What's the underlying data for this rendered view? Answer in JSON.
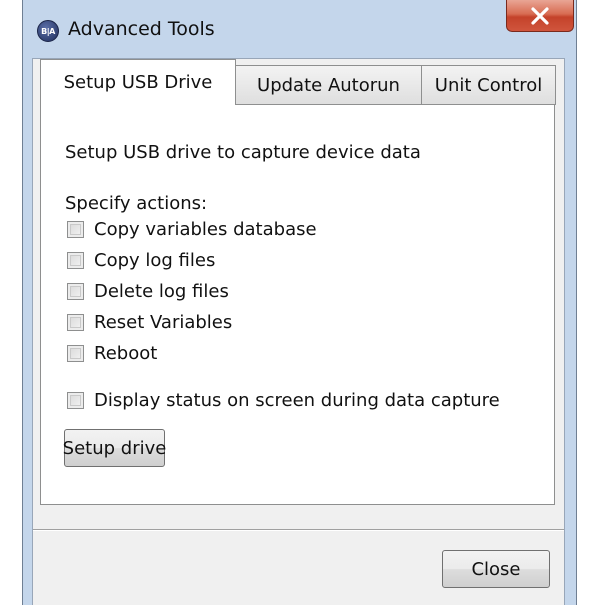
{
  "window": {
    "title": "Advanced Tools",
    "icon_text": "B|A"
  },
  "tabs": [
    {
      "label": "Setup USB Drive",
      "active": true
    },
    {
      "label": "Update Autorun",
      "active": false
    },
    {
      "label": "Unit Control",
      "active": false
    }
  ],
  "panel": {
    "description": "Setup USB drive to capture device data",
    "actions_heading": "Specify actions:",
    "actions": [
      {
        "label": "Copy variables database",
        "checked": false
      },
      {
        "label": "Copy log files",
        "checked": false
      },
      {
        "label": "Delete log files",
        "checked": false
      },
      {
        "label": "Reset Variables",
        "checked": false
      },
      {
        "label": "Reboot",
        "checked": false
      }
    ],
    "display_status": {
      "label": "Display status on screen during data capture",
      "checked": false
    },
    "setup_button": "Setup drive"
  },
  "footer": {
    "close_button": "Close"
  }
}
